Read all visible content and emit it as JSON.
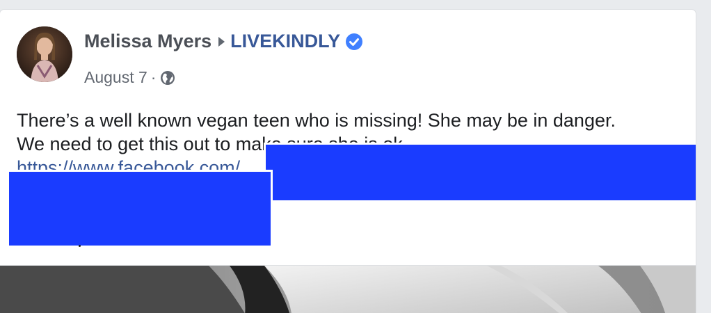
{
  "post": {
    "author": "Melissa Myers",
    "page": "LIVEKINDLY",
    "date": "August 7",
    "meta_separator": "·",
    "text_line_1": "There’s a well known vegan teen who is missing! She may be in danger.",
    "text_line_2": "We need to get this out to make sure she is ok",
    "link": "https://www.facebook.com/"
  },
  "icons": {
    "arrow": "right-triangle-icon",
    "verified": "verified-badge-icon",
    "privacy": "globe-icon"
  },
  "colors": {
    "author_text": "#4b4f56",
    "page_link": "#385898",
    "verified_badge": "#4080ff",
    "meta_text": "#616770",
    "body_text": "#1c1e21",
    "redaction": "#1a3cff",
    "background": "#e9ebee"
  }
}
